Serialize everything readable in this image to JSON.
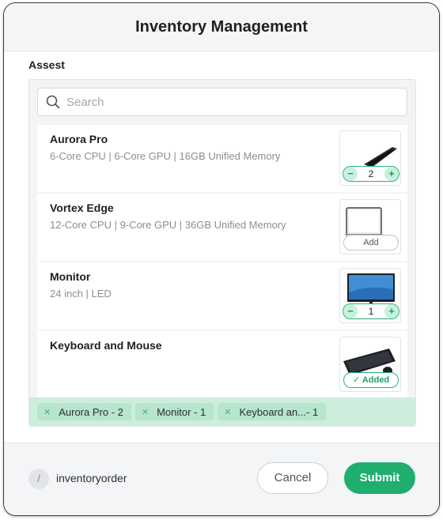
{
  "header": {
    "title": "Inventory Management"
  },
  "section": {
    "label": "Assest"
  },
  "search": {
    "placeholder": "Search",
    "value": ""
  },
  "items": [
    {
      "name": "Aurora Pro",
      "spec": "6-Core CPU | 6-Core GPU | 16GB Unified Memory",
      "quantity": "2",
      "control": "stepper",
      "image": "laptop-dark-icon"
    },
    {
      "name": "Vortex Edge",
      "spec": "12-Core CPU | 9-Core GPU | 36GB Unified Memory",
      "control": "add",
      "add_label": "Add",
      "image": "laptop-silver-icon"
    },
    {
      "name": "Monitor",
      "spec": "24 inch | LED",
      "quantity": "1",
      "control": "stepper",
      "image": "monitor-icon"
    },
    {
      "name": "Keyboard and Mouse",
      "spec": "",
      "control": "added",
      "added_label": "Added",
      "image": "keyboard-mouse-icon"
    }
  ],
  "stepper": {
    "minus": "−",
    "plus": "+"
  },
  "chips": [
    {
      "label": "Aurora Pro - 2"
    },
    {
      "label": "Monitor - 1"
    },
    {
      "label_name": "Keyboard an...",
      "label_qty": " - 1"
    }
  ],
  "footer": {
    "slash": "/",
    "order_name": "inventoryorder",
    "cancel_label": "Cancel",
    "submit_label": "Submit"
  },
  "colors": {
    "accent": "#1fae6d",
    "chip_bg": "#cdeedd",
    "header_bg": "#f4f5f7"
  }
}
